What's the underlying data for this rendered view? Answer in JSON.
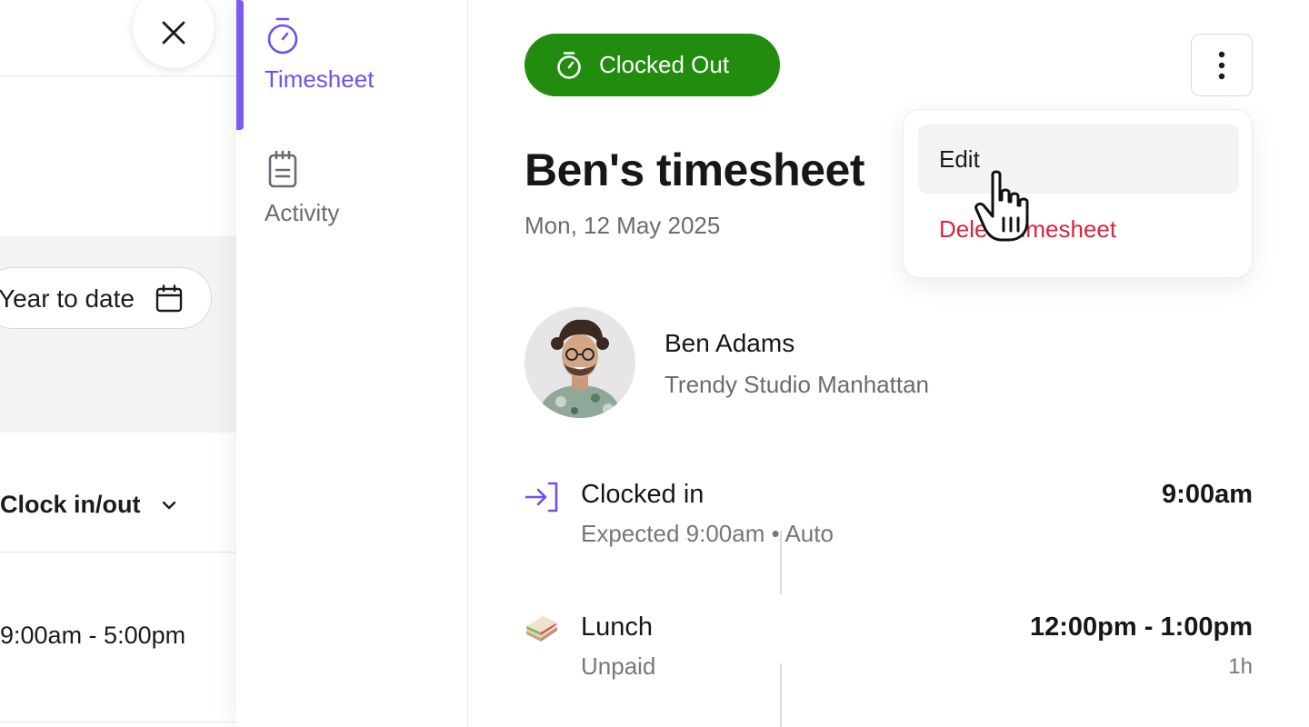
{
  "background_page": {
    "date_range_label": "Year to date",
    "section_title": "Clock in/out",
    "shift_time": "9:00am - 5:00pm"
  },
  "nav": {
    "items": [
      {
        "label": "Timesheet",
        "icon": "stopwatch-icon",
        "active": true
      },
      {
        "label": "Activity",
        "icon": "notepad-icon",
        "active": false
      }
    ]
  },
  "header": {
    "status": "Clocked Out",
    "status_color": "#228c0e"
  },
  "menu": {
    "items": [
      {
        "label": "Edit"
      },
      {
        "label": "Delete timesheet",
        "color": "#d7263d"
      }
    ]
  },
  "main": {
    "title": "Ben's timesheet",
    "date": "Mon, 12 May 2025",
    "person": {
      "name": "Ben Adams",
      "location": "Trendy Studio Manhattan"
    },
    "timeline": [
      {
        "icon": "clock-in-icon",
        "title": "Clocked in",
        "subtitle": "Expected 9:00am • Auto",
        "time": "9:00am"
      },
      {
        "icon": "sandwich-icon",
        "title": "Lunch",
        "subtitle": "Unpaid",
        "time": "12:00pm - 1:00pm",
        "duration": "1h"
      }
    ]
  },
  "colors": {
    "accent": "#6f4ff2",
    "danger": "#d7263d",
    "success": "#228c0e"
  }
}
